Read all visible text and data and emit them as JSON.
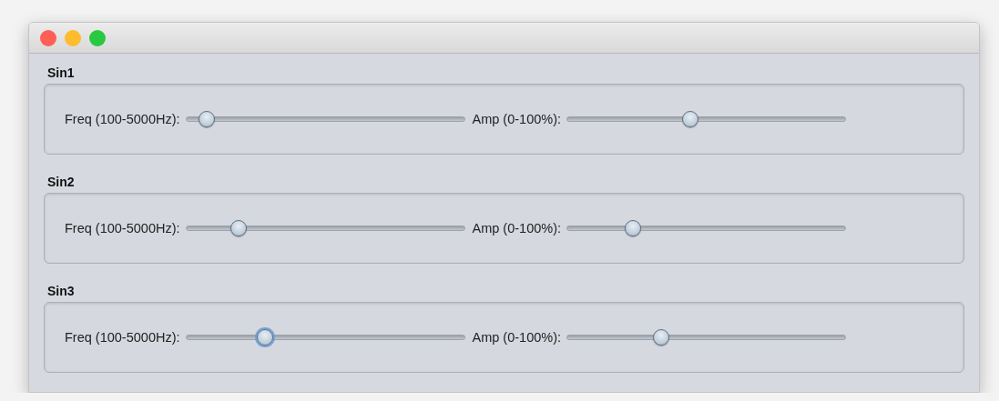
{
  "groups": [
    {
      "title": "Sin1",
      "sliders": [
        {
          "label": "Freq (100-5000Hz):",
          "level": 0.05,
          "focused": false
        },
        {
          "label": "Amp (0-100%):",
          "level": 0.44,
          "focused": false
        }
      ]
    },
    {
      "title": "Sin2",
      "sliders": [
        {
          "label": "Freq (100-5000Hz):",
          "level": 0.17,
          "focused": false
        },
        {
          "label": "Amp (0-100%):",
          "level": 0.22,
          "focused": false
        }
      ]
    },
    {
      "title": "Sin3",
      "sliders": [
        {
          "label": "Freq (100-5000Hz):",
          "level": 0.27,
          "focused": true
        },
        {
          "label": "Amp (0-100%):",
          "level": 0.33,
          "focused": false
        }
      ]
    }
  ]
}
